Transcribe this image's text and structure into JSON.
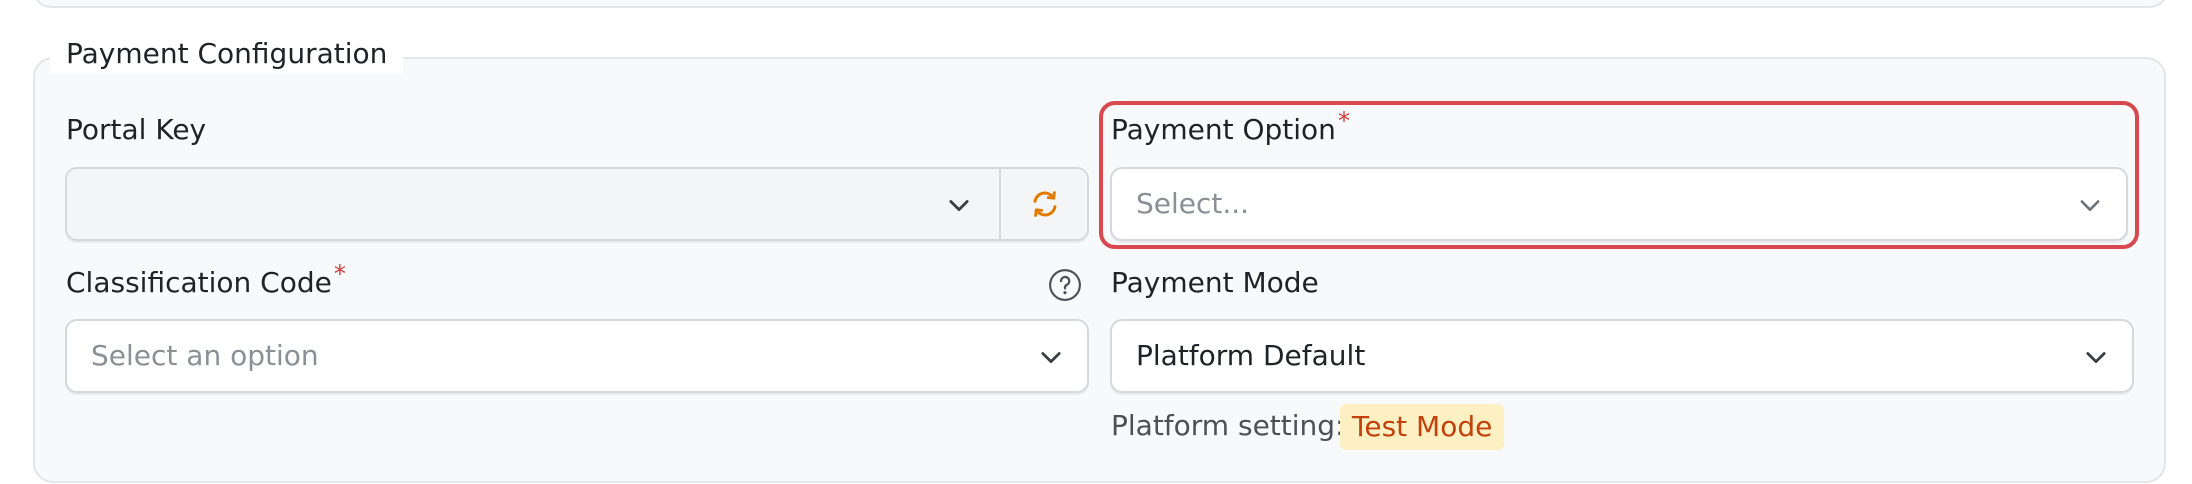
{
  "section": {
    "legend": "Payment Configuration"
  },
  "portal_key": {
    "label": "Portal Key",
    "value": ""
  },
  "payment_option": {
    "label": "Payment Option",
    "required_marker": "*",
    "placeholder": "Select..."
  },
  "classification_code": {
    "label": "Classification Code",
    "required_marker": "*",
    "placeholder": "Select an option"
  },
  "payment_mode": {
    "label": "Payment Mode",
    "value": "Platform Default",
    "note_label": "Platform setting:",
    "badge": "Test Mode"
  },
  "colors": {
    "accent_orange": "#e07b00",
    "required_red": "#d03b3b",
    "highlight_red": "#d9474f",
    "badge_bg": "#fdf0c2",
    "badge_text": "#c2410c"
  },
  "icons": {
    "dropdown": "chevron-down-icon",
    "refresh": "refresh-icon",
    "help": "help-circle-icon"
  }
}
